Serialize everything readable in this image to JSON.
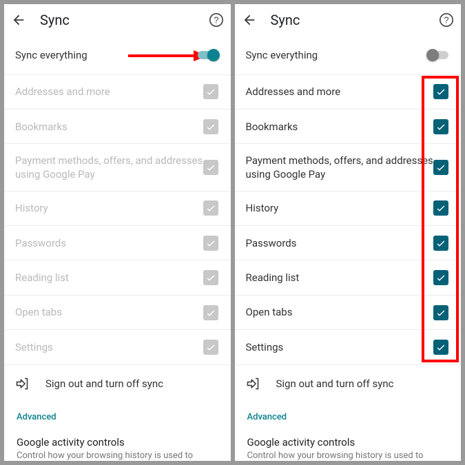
{
  "left": {
    "title": "Sync",
    "sync_everything": "Sync everything",
    "items": [
      "Addresses and more",
      "Bookmarks",
      "Payment methods, offers, and addresses using Google Pay",
      "History",
      "Passwords",
      "Reading list",
      "Open tabs",
      "Settings"
    ],
    "signout": "Sign out and turn off sync",
    "advanced": "Advanced",
    "activity_title": "Google activity controls",
    "activity_sub": "Control how your browsing history is used to"
  },
  "right": {
    "title": "Sync",
    "sync_everything": "Sync everything",
    "items": [
      "Addresses and more",
      "Bookmarks",
      "Payment methods, offers, and addresses using Google Pay",
      "History",
      "Passwords",
      "Reading list",
      "Open tabs",
      "Settings"
    ],
    "signout": "Sign out and turn off sync",
    "advanced": "Advanced",
    "activity_title": "Google activity controls",
    "activity_sub": "Control how your browsing history is used to"
  }
}
